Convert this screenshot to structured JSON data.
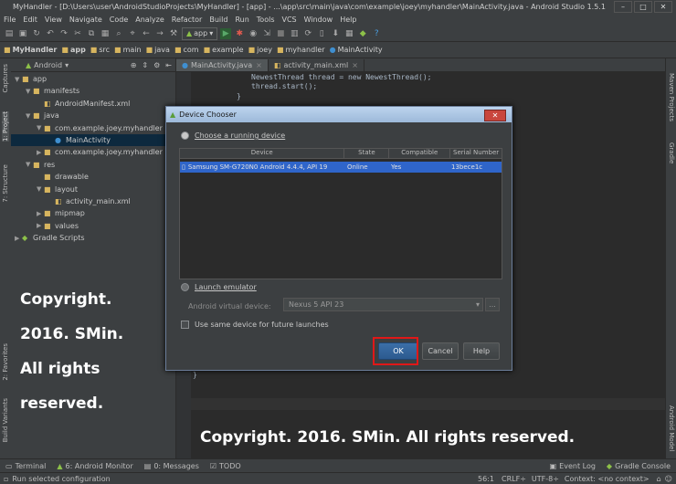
{
  "window": {
    "title": "MyHandler - [D:\\Users\\user\\AndroidStudioProjects\\MyHandler] - [app] - ...\\app\\src\\main\\java\\com\\example\\joey\\myhandler\\MainActivity.java - Android Studio 1.5.1",
    "minimize": "–",
    "maximize": "□",
    "close": "✕"
  },
  "menu": [
    "File",
    "Edit",
    "View",
    "Navigate",
    "Code",
    "Analyze",
    "Refactor",
    "Build",
    "Run",
    "Tools",
    "VCS",
    "Window",
    "Help"
  ],
  "toolbar": {
    "run_config": "app"
  },
  "breadcrumbs": [
    "MyHandler",
    "app",
    "src",
    "main",
    "java",
    "com",
    "example",
    "joey",
    "myhandler",
    "MainActivity"
  ],
  "project_panel": {
    "view_selector": "Android",
    "tree": [
      {
        "label": "app",
        "level": 0,
        "icon": "folder"
      },
      {
        "label": "manifests",
        "level": 1,
        "icon": "folder"
      },
      {
        "label": "AndroidManifest.xml",
        "level": 2,
        "icon": "file"
      },
      {
        "label": "java",
        "level": 1,
        "icon": "folder"
      },
      {
        "label": "com.example.joey.myhandler",
        "level": 2,
        "icon": "package"
      },
      {
        "label": "MainActivity",
        "level": 3,
        "icon": "class",
        "selected": true
      },
      {
        "label": "com.example.joey.myhandler (an",
        "level": 2,
        "icon": "package"
      },
      {
        "label": "res",
        "level": 1,
        "icon": "folder"
      },
      {
        "label": "drawable",
        "level": 2,
        "icon": "folder"
      },
      {
        "label": "layout",
        "level": 2,
        "icon": "folder"
      },
      {
        "label": "activity_main.xml",
        "level": 3,
        "icon": "file"
      },
      {
        "label": "mipmap",
        "level": 2,
        "icon": "folder"
      },
      {
        "label": "values",
        "level": 2,
        "icon": "folder"
      },
      {
        "label": "Gradle Scripts",
        "level": 0,
        "icon": "gradle"
      }
    ]
  },
  "left_strip": {
    "captures": "Captures",
    "project": "1: Project",
    "structure": "7: Structure",
    "favorites": "2: Favorites",
    "build_variants": "Build Variants"
  },
  "right_strip": {
    "maven": "Maven Projects",
    "gradle": "Gradle",
    "android_model": "Android Model"
  },
  "editor": {
    "tabs": [
      {
        "label": "MainActivity.java",
        "active": true
      },
      {
        "label": "activity_main.xml",
        "active": false
      }
    ],
    "code_lines": [
      "NewestThread thread = new NewestThread();",
      "thread.start();",
      "}",
      "}"
    ]
  },
  "dialog": {
    "title": "Device Chooser",
    "choose_running": "Choose a running device",
    "columns": [
      "Device",
      "State",
      "Compatible",
      "Serial Number"
    ],
    "devices": [
      {
        "device": "Samsung SM-G720N0 Android 4.4.4, API 19",
        "state": "Online",
        "compatible": "Yes",
        "serial": "13bece1c"
      }
    ],
    "launch_emulator": "Launch emulator",
    "avd_label": "Android virtual device:",
    "avd_value": "Nexus 5 API 23",
    "more_button": "...",
    "same_device": "Use same device for future launches",
    "ok": "OK",
    "cancel": "Cancel",
    "help": "Help"
  },
  "watermark": {
    "left_lines": [
      "Copyright.",
      "2016. SMin.",
      "All rights",
      "reserved."
    ],
    "bottom": "Copyright. 2016. SMin. All rights reserved."
  },
  "bottom_tools": [
    "Terminal",
    "6: Android Monitor",
    "0: Messages",
    "TODO",
    "Event Log",
    "Gradle Console"
  ],
  "status": {
    "message": "Run selected configuration",
    "position": "56:1",
    "line_sep": "CRLF÷",
    "encoding": "UTF-8÷",
    "context": "Context: <no context>"
  }
}
